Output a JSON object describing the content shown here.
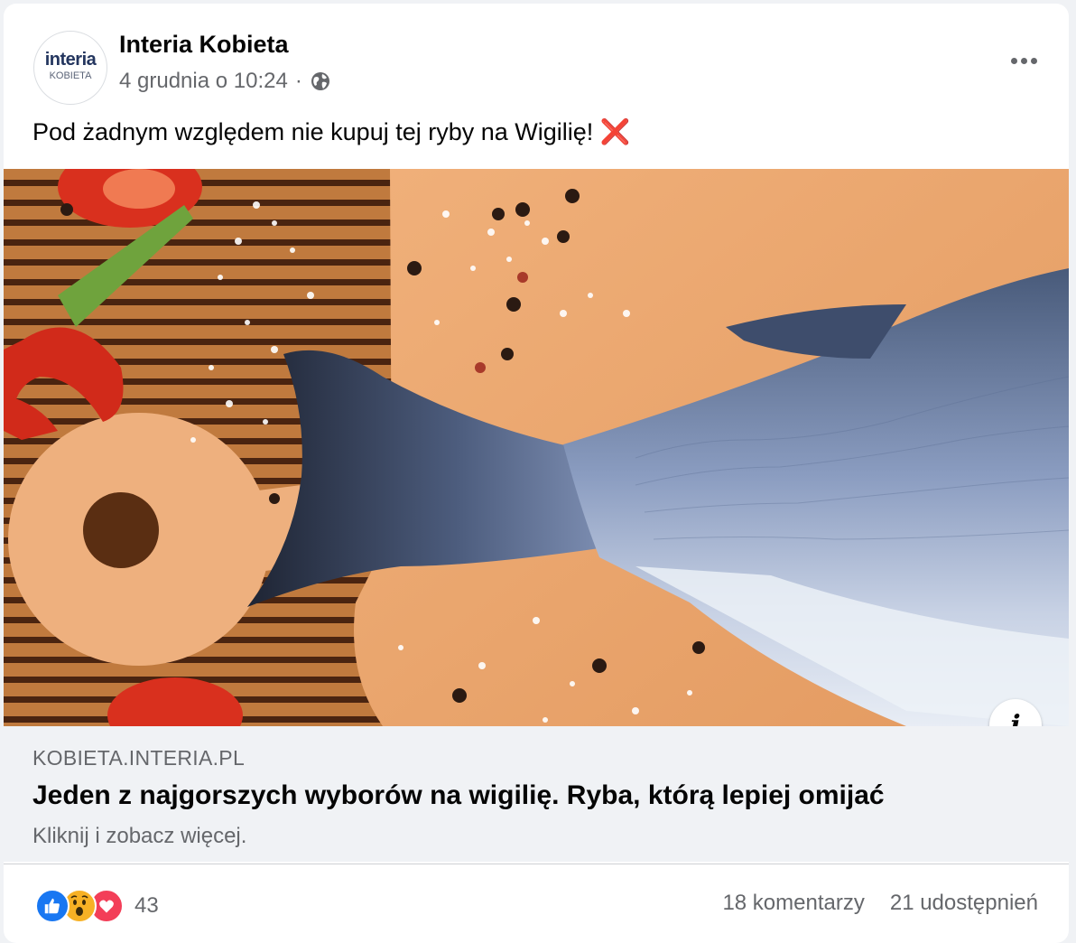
{
  "post": {
    "page_name": "Interia Kobieta",
    "avatar": {
      "brand": "interia",
      "sub": "KOBIETA"
    },
    "timestamp": "4 grudnia o 10:24",
    "separator": "·",
    "privacy_icon": "globe-icon",
    "more_icon": "more-options-icon",
    "text": "Pod żadnym względem nie kupuj tej ryby na Wigilię!",
    "emoji": "❌"
  },
  "link": {
    "domain": "KOBIETA.INTERIA.PL",
    "title": "Jeden z najgorszych wyborów na wigilię. Ryba, którą lepiej omijać",
    "description": "Kliknij i zobacz więcej.",
    "info_icon": "info-icon",
    "info_glyph": "i"
  },
  "engagement": {
    "reactions": [
      "like",
      "wow",
      "love"
    ],
    "reaction_count": "43",
    "comments": "18 komentarzy",
    "shares": "21 udostępnień"
  },
  "colors": {
    "like": "#1877f2",
    "wow": "#f7b125",
    "love": "#f33e58",
    "secondary_text": "#65676b"
  }
}
